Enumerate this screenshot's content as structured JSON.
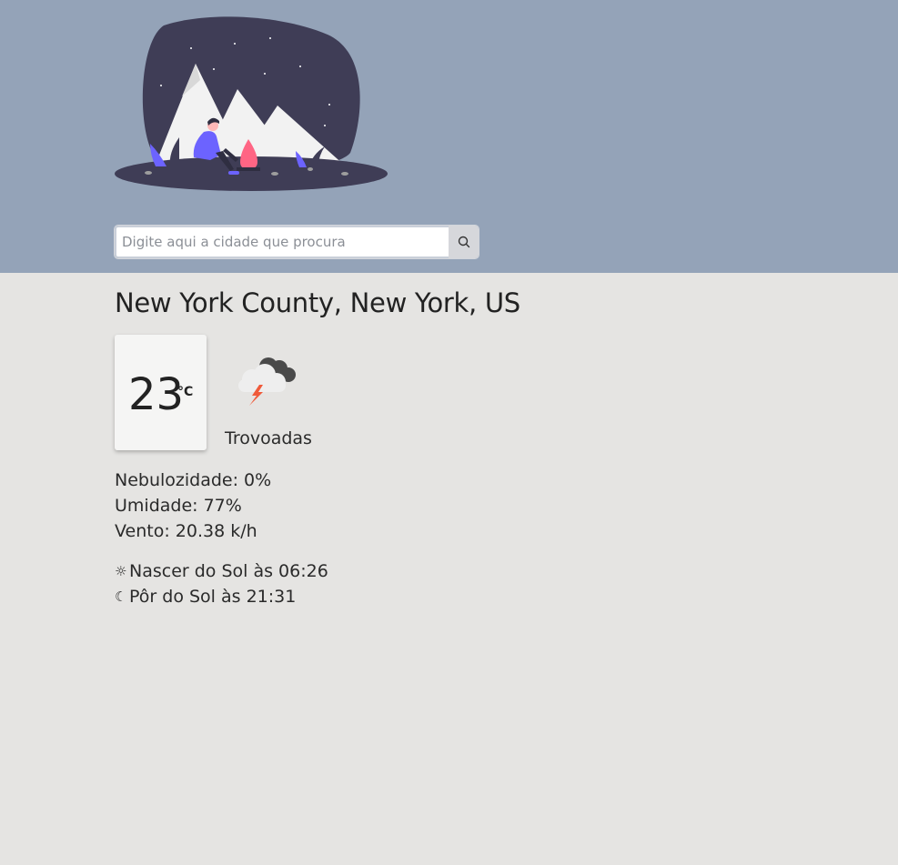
{
  "search": {
    "placeholder": "Digite aqui a cidade que procura",
    "value": "",
    "button_icon": "search-icon"
  },
  "header": {
    "background_color": "#94a3b8",
    "illustration": "camping-mountains-illustration"
  },
  "location": {
    "name": "New York County, New York, US"
  },
  "current": {
    "temperature": "23",
    "unit": "°C",
    "condition": "Trovoadas",
    "condition_icon": "thunderstorm-icon"
  },
  "details": {
    "cloudiness": "Nebulozidade: 0%",
    "humidity": "Umidade: 77%",
    "wind": "Vento: 20.38 k/h"
  },
  "sun": {
    "sunrise_icon": "☼",
    "sunrise": "Nascer do Sol às 06:26",
    "sunset_icon": "☾",
    "sunset": "Pôr do Sol às 21:31"
  }
}
